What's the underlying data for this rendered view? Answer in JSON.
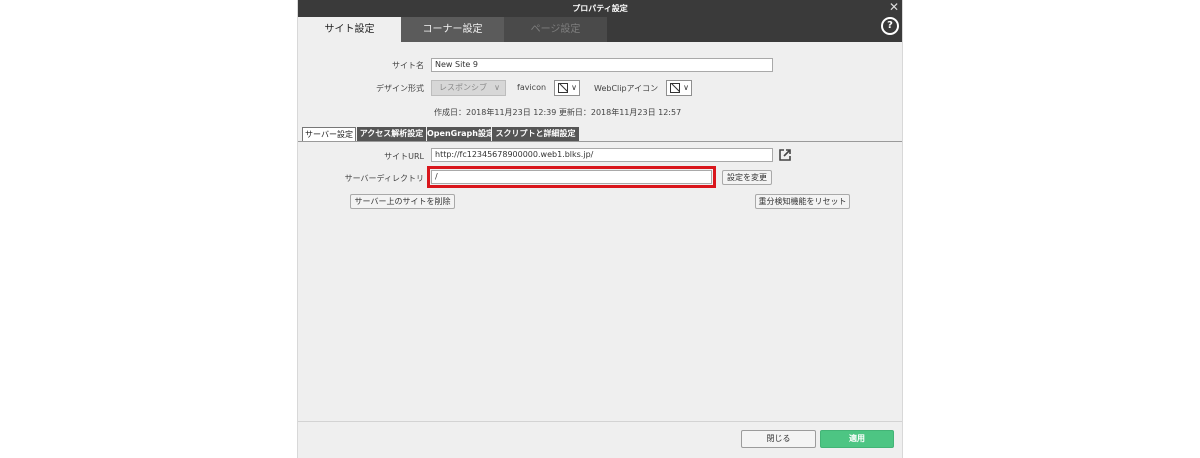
{
  "dialog": {
    "title": "プロパティ設定",
    "close_glyph": "✕",
    "help_glyph": "?"
  },
  "main_tabs": [
    {
      "label": "サイト設定",
      "state": "active"
    },
    {
      "label": "コーナー設定",
      "state": "inactive"
    },
    {
      "label": "ページ設定",
      "state": "disabled"
    }
  ],
  "site": {
    "name_label": "サイト名",
    "name_value": "New Site 9",
    "design_label": "デザイン形式",
    "design_value": "レスポンシブ",
    "favicon_label": "favicon",
    "webclip_label": "WebClipアイコン",
    "dates": "作成日：2018年11月23日 12:39 更新日：2018年11月23日 12:57"
  },
  "sub_tabs": [
    {
      "label": "サーバー設定",
      "state": "active"
    },
    {
      "label": "アクセス解析設定",
      "state": "inactive"
    },
    {
      "label": "OpenGraph設定",
      "state": "inactive"
    },
    {
      "label": "スクリプトと詳細設定",
      "state": "inactive"
    }
  ],
  "server": {
    "url_label": "サイトURL",
    "url_value": "http://fc12345678900000.web1.blks.jp/",
    "dir_label": "サーバーディレクトリ",
    "dir_value": "/",
    "change_button": "設定を変更",
    "delete_button": "サーバー上のサイトを削除",
    "reset_button": "重分検知機能をリセット"
  },
  "footer": {
    "close_button": "閉じる",
    "apply_button": "適用"
  },
  "colors": {
    "titlebar": "#3a3a3a",
    "highlight": "#d9161c",
    "apply": "#4dc583"
  }
}
